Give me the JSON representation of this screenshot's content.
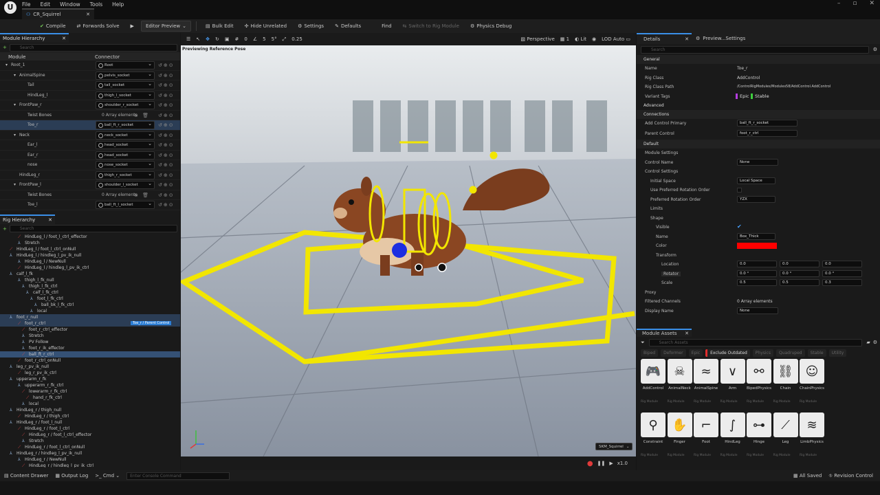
{
  "app": {
    "menu": [
      "File",
      "Edit",
      "Window",
      "Tools",
      "Help"
    ],
    "document_tab": "CR_Squirrel"
  },
  "toolbar": {
    "compile": "Compile",
    "forwards_solve": "Forwards Solve",
    "editor_preview": "Editor Preview",
    "bulk_edit": "Bulk Edit",
    "hide_unrelated": "Hide Unrelated",
    "settings": "Settings",
    "defaults": "Defaults",
    "find": "Find",
    "switch_rig_module": "Switch to Rig Module",
    "physics_debug": "Physics Debug"
  },
  "module_hierarchy": {
    "tab": "Module Hierarchy",
    "search_placeholder": "Search",
    "col_module": "Module",
    "col_connector": "Connector",
    "rows": [
      {
        "name": "Root_1",
        "connector": "Root"
      },
      {
        "name": "AnimalSpine",
        "connector": "pelvis_socket"
      },
      {
        "name": "Tail",
        "connector": "tail_socket"
      },
      {
        "name": "HindLeg_l",
        "connector": "thigh_l_socket"
      },
      {
        "name": "FrontPaw_r",
        "connector": "shoulder_r_socket"
      },
      {
        "name": "Twist Bones",
        "connector": "0 Array elements"
      },
      {
        "name": "Toe_r",
        "connector": "ball_ft_r_socket"
      },
      {
        "name": "Neck",
        "connector": "neck_socket"
      },
      {
        "name": "Ear_l",
        "connector": "head_socket"
      },
      {
        "name": "Ear_r",
        "connector": "head_socket"
      },
      {
        "name": "nose",
        "connector": "nose_socket"
      },
      {
        "name": "HindLeg_r",
        "connector": "thigh_r_socket"
      },
      {
        "name": "FrontPaw_l",
        "connector": "shoulder_l_socket"
      },
      {
        "name": "Twist Bones",
        "connector": "0 Array elements"
      },
      {
        "name": "Toe_l",
        "connector": "ball_ft_l_socket"
      }
    ]
  },
  "rig_hierarchy": {
    "tab": "Rig Hierarchy",
    "search_placeholder": "Search",
    "badge": "Toe_r / Parent Control",
    "rows": [
      "HindLeg_l / foot_l_ctrl_effector",
      "Stretch",
      "HindLeg_l / foot_l_ctrl_onNull",
      "HindLeg_l / hindleg_l_pv_ik_null",
      "HindLeg_l / NewNull",
      "HindLeg_l / hindleg_l_pv_ik_ctrl",
      "calf_l_fk",
      "thigh_l_fk_null",
      "thigh_l_fk_ctrl",
      "calf_l_fk_ctrl",
      "foot_l_fk_ctrl",
      "ball_bk_l_fk_ctrl",
      "local",
      "foot_r_null",
      "foot_r_ctrl",
      "foot_r_ctrl_effector",
      "Stretch",
      "PV Follow",
      "foot_r_ik_effector",
      "ball_ft_r_ctrl",
      "foot_r_ctrl_onNull",
      "leg_r_pv_ik_null",
      "leg_r_pv_ik_ctrl",
      "upperarm_r_fk",
      "upperarm_r_fk_ctrl",
      "lowerarm_r_fk_ctrl",
      "hand_r_fk_ctrl",
      "local",
      "HindLeg_r / thigh_null",
      "HindLeg_r / thigh_ctrl",
      "HindLeg_r / foot_l_null",
      "HindLeg_r / foot_l_ctrl",
      "HindLeg_r / foot_l_ctrl_effector",
      "Stretch",
      "HindLeg_r / foot_l_ctrl_onNull",
      "HindLeg_r / hindleg_l_pv_ik_null",
      "HindLeg_r / NewNull",
      "HindLeg_r / hindleg_l_pv_ik_ctrl"
    ]
  },
  "viewport": {
    "perspective": "Perspective",
    "lit": "Lit",
    "lod": "LOD Auto",
    "angle_snap": "5°",
    "scale_snap": "0.25",
    "grid_snap": "0",
    "snap5": "5",
    "camera_speed": "1",
    "overlay_text": "Previewing Reference Pose",
    "mesh_selector": "SKM_Squirrel",
    "playback_rate": "x1.0"
  },
  "details": {
    "tab": "Details",
    "tab2": "Preview...Settings",
    "search_placeholder": "Search",
    "general": "General",
    "name_label": "Name",
    "name_value": "Toe_r",
    "rig_class_label": "Rig Class",
    "rig_class_value": "AddControl",
    "rig_class_path_label": "Rig Class Path",
    "rig_class_path_value": "/ControlRigModules/Modules58/AddControl.AddControl",
    "variant_tags_label": "Variant Tags",
    "tag_epic": "Epic",
    "tag_stable": "Stable",
    "advanced": "Advanced",
    "connections": "Connections",
    "add_control_primary_label": "Add Control Primary",
    "add_control_primary_value": "ball_ft_r_socket",
    "parent_control_label": "Parent Control",
    "parent_control_value": "foot_r_ctrl",
    "default": "Default",
    "module_settings": "Module Settings",
    "control_name_label": "Control Name",
    "control_name_value": "None",
    "control_settings": "Control Settings",
    "initial_space_label": "Initial Space",
    "initial_space_value": "Local Space",
    "use_pref_rot_label": "Use Preferred Rotation Order",
    "pref_rot_label": "Preferred Rotation Order",
    "pref_rot_value": "YZX",
    "limits": "Limits",
    "shape": "Shape",
    "visible_label": "Visible",
    "shape_name_label": "Name",
    "shape_name_value": "Box_Thick",
    "color_label": "Color",
    "color_value": "#ff0000",
    "transform": "Transform",
    "location_label": "Location",
    "location": [
      "0.0",
      "0.0",
      "0.0"
    ],
    "rotator_label": "Rotator",
    "rotator": [
      "0.0 °",
      "0.0 °",
      "0.0 °"
    ],
    "scale_label": "Scale",
    "scale": [
      "0.5",
      "0.5",
      "0.3"
    ],
    "proxy": "Proxy",
    "filtered_channels_label": "Filtered Channels",
    "filtered_channels_value": "0 Array elements",
    "display_name_label": "Display Name",
    "display_name_value": "None"
  },
  "module_assets": {
    "tab": "Module Assets",
    "search_placeholder": "Search Assets",
    "filters": [
      "Biped",
      "Deformer",
      "Epic",
      "Exclude Outdated",
      "Physics",
      "Quadruped",
      "Stable",
      "Utility"
    ],
    "active_filter": "Exclude Outdated",
    "sub_label": "Rig Module",
    "tiles_row1": [
      "AddControl",
      "AnimalNeck",
      "AnimalSpine",
      "Arm",
      "BipedPhysics",
      "Chain",
      "ChainPhysics"
    ],
    "tiles_row2": [
      "Constraint",
      "Finger",
      "Foot",
      "HindLeg",
      "Hinge",
      "Leg",
      "LimbPhysics"
    ]
  },
  "statusbar": {
    "content_drawer": "Content Drawer",
    "output_log": "Output Log",
    "cmd": "Cmd",
    "console_placeholder": "Enter Console Command",
    "all_saved": "All Saved",
    "revision_control": "Revision Control"
  },
  "colors": {
    "accent_yellow": "#f2e600",
    "selection_blue": "#355175",
    "epic_tag": "#b43de0",
    "stable_tag": "#3ecf3e",
    "exclude_outdated": "#e12d2d"
  }
}
